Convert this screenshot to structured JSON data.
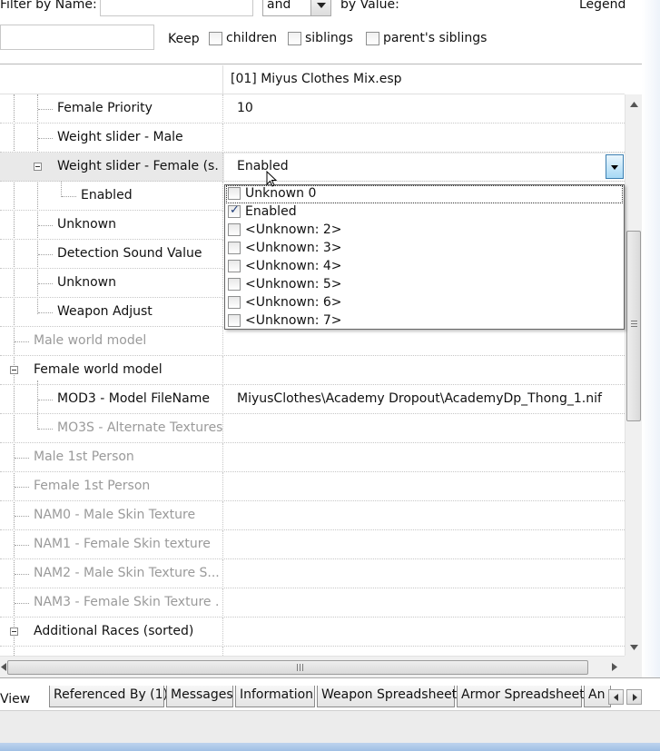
{
  "filter": {
    "name_label": "Filter by Name:",
    "name_value": "",
    "operator_value": "and",
    "value_label": "by Value:",
    "legend_label": "Legend",
    "second_value": "",
    "keep_label": "Keep",
    "keep_options": [
      {
        "label": "children",
        "checked": false
      },
      {
        "label": "siblings",
        "checked": false
      },
      {
        "label": "parent's siblings",
        "checked": false
      }
    ]
  },
  "grid": {
    "column_header": "[01] Miyus Clothes Mix.esp",
    "rows": [
      {
        "name": "Female Priority",
        "value": "10"
      },
      {
        "name": "Weight slider - Male",
        "value": ""
      },
      {
        "name": "Weight slider - Female (s...",
        "value": "Enabled"
      },
      {
        "name": "Enabled",
        "value": ""
      },
      {
        "name": "Unknown",
        "value": ""
      },
      {
        "name": "Detection Sound Value",
        "value": ""
      },
      {
        "name": "Unknown",
        "value": ""
      },
      {
        "name": "Weapon Adjust",
        "value": ""
      },
      {
        "name": "Male world model",
        "value": ""
      },
      {
        "name": "Female world model",
        "value": ""
      },
      {
        "name": "MOD3 - Model FileName",
        "value": "MiyusClothes\\Academy Dropout\\AcademyDp_Thong_1.nif"
      },
      {
        "name": "MO3S - Alternate Textures",
        "value": ""
      },
      {
        "name": "Male 1st Person",
        "value": ""
      },
      {
        "name": "Female 1st Person",
        "value": ""
      },
      {
        "name": "NAM0 - Male Skin Texture",
        "value": ""
      },
      {
        "name": "NAM1 - Female Skin texture",
        "value": ""
      },
      {
        "name": "NAM2 - Male Skin Texture S...",
        "value": ""
      },
      {
        "name": "NAM3 - Female Skin Texture ...",
        "value": ""
      },
      {
        "name": "Additional Races (sorted)",
        "value": ""
      }
    ]
  },
  "dropdown": {
    "items": [
      {
        "label": "Unknown 0",
        "checked": false
      },
      {
        "label": "Enabled",
        "checked": true
      },
      {
        "label": "<Unknown: 2>",
        "checked": false
      },
      {
        "label": "<Unknown: 3>",
        "checked": false
      },
      {
        "label": "<Unknown: 4>",
        "checked": false
      },
      {
        "label": "<Unknown: 5>",
        "checked": false
      },
      {
        "label": "<Unknown: 6>",
        "checked": false
      },
      {
        "label": "<Unknown: 7>",
        "checked": false
      }
    ]
  },
  "tabs": [
    {
      "label": "View",
      "active": true
    },
    {
      "label": "Referenced By (1)",
      "active": false
    },
    {
      "label": "Messages",
      "active": false
    },
    {
      "label": "Information",
      "active": false
    },
    {
      "label": "Weapon Spreadsheet",
      "active": false
    },
    {
      "label": "Armor Spreadsheet",
      "active": false
    },
    {
      "label": "An",
      "active": false
    }
  ],
  "colors": {
    "disabled_text": "#9a9a9a",
    "selected_row": "#e9e9e9",
    "check_blue": "#1d3c78"
  }
}
